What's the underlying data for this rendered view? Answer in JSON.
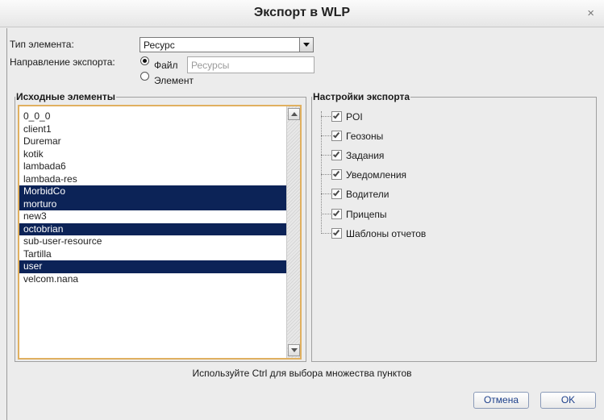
{
  "dialog": {
    "title": "Экспорт в WLP",
    "close_glyph": "×"
  },
  "form": {
    "element_type_label": "Тип элемента:",
    "element_type_value": "Ресурс",
    "direction_label": "Направление экспорта:",
    "direction_options": [
      {
        "label": "Файл",
        "checked": true
      },
      {
        "label": "Элемент",
        "checked": false
      }
    ],
    "file_placeholder": "Ресурсы"
  },
  "source": {
    "legend": "Исходные элементы",
    "items": [
      {
        "label": "0_0_0",
        "selected": false
      },
      {
        "label": "client1",
        "selected": false
      },
      {
        "label": "Duremar",
        "selected": false
      },
      {
        "label": "kotik",
        "selected": false
      },
      {
        "label": "lambada6",
        "selected": false
      },
      {
        "label": "lambada-res",
        "selected": false
      },
      {
        "label": "MorbidCo",
        "selected": true
      },
      {
        "label": "morturo",
        "selected": true
      },
      {
        "label": "new3",
        "selected": false
      },
      {
        "label": "octobrian",
        "selected": true
      },
      {
        "label": "sub-user-resource",
        "selected": false
      },
      {
        "label": "Tartilla",
        "selected": false
      },
      {
        "label": "user",
        "selected": true
      },
      {
        "label": "velcom.nana",
        "selected": false
      }
    ]
  },
  "settings": {
    "legend": "Настройки экспорта",
    "items": [
      {
        "label": "POI",
        "checked": true
      },
      {
        "label": "Геозоны",
        "checked": true
      },
      {
        "label": "Задания",
        "checked": true
      },
      {
        "label": "Уведомления",
        "checked": true
      },
      {
        "label": "Водители",
        "checked": true
      },
      {
        "label": "Прицепы",
        "checked": true
      },
      {
        "label": "Шаблоны отчетов",
        "checked": true
      }
    ]
  },
  "hint": "Используйте Ctrl для выбора множества пунктов",
  "buttons": {
    "cancel": "Отмена",
    "ok": "OK"
  },
  "colors": {
    "selection": "#0c2357",
    "list_border": "#e0b060",
    "button_text": "#1c3f8a"
  }
}
